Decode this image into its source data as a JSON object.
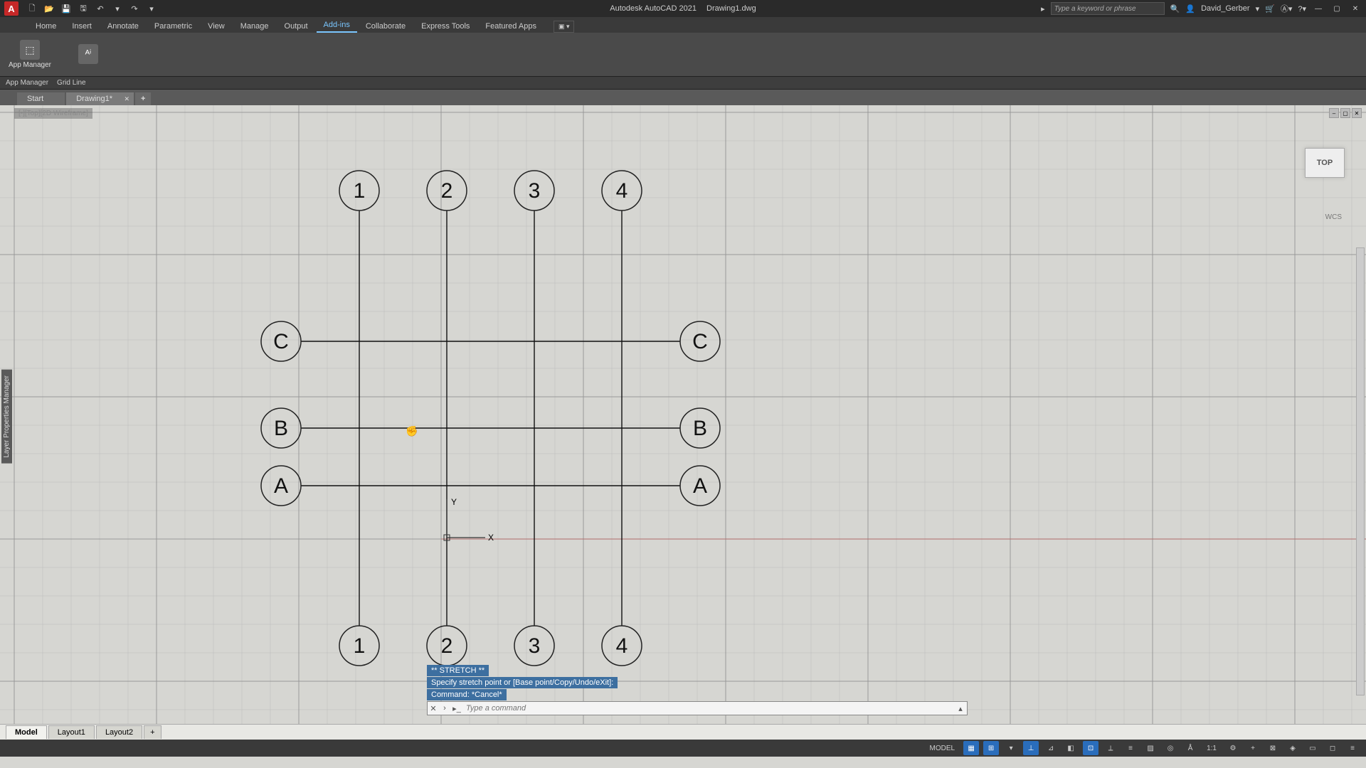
{
  "title": {
    "app": "Autodesk AutoCAD 2021",
    "file": "Drawing1.dwg"
  },
  "qat": [
    {
      "name": "new",
      "glyph": "🗋"
    },
    {
      "name": "open",
      "glyph": "📂"
    },
    {
      "name": "save",
      "glyph": "💾"
    },
    {
      "name": "saveas",
      "glyph": "🖫"
    },
    {
      "name": "undo",
      "glyph": "↶"
    },
    {
      "name": "undo-drop",
      "glyph": "▾"
    },
    {
      "name": "redo",
      "glyph": "↷"
    },
    {
      "name": "redo-drop",
      "glyph": "▾"
    }
  ],
  "search": {
    "placeholder": "Type a keyword or phrase"
  },
  "user": {
    "name": "David_Gerber"
  },
  "ribbon_tabs": [
    "Home",
    "Insert",
    "Annotate",
    "Parametric",
    "View",
    "Manage",
    "Output",
    "Add-ins",
    "Collaborate",
    "Express Tools",
    "Featured Apps"
  ],
  "active_ribbon_tab": 7,
  "ribbon_panels": [
    {
      "label": "App Manager",
      "icon": "⬚"
    },
    {
      "label": "",
      "icon": "ᴬⁱ"
    }
  ],
  "ribbon_sub": [
    "App Manager",
    "Grid Line"
  ],
  "doc_tabs": [
    {
      "label": "Start",
      "active": false
    },
    {
      "label": "Drawing1*",
      "active": true
    }
  ],
  "canvas_badge": "[-][Top][2D Wireframe]",
  "viewcube": "TOP",
  "wcs": "WCS",
  "ucs": {
    "y": "Y",
    "x": "X"
  },
  "grid_bubbles": {
    "top": [
      "1",
      "2",
      "3",
      "4"
    ],
    "bottom": [
      "1",
      "2",
      "3",
      "4"
    ],
    "left": [
      "C",
      "B",
      "A"
    ],
    "right": [
      "C",
      "B",
      "A"
    ]
  },
  "layout_tabs": [
    "Model",
    "Layout1",
    "Layout2"
  ],
  "active_layout": 0,
  "cmd_history": [
    {
      "text": "** STRETCH **",
      "hl": true
    },
    {
      "text": "Specify stretch point or [Base point/Copy/Undo/eXit]:",
      "hl": true
    },
    {
      "text": "Command: *Cancel*",
      "hl": true
    }
  ],
  "cmd_input": {
    "placeholder": "Type a command"
  },
  "statusbar": {
    "model": "MODEL",
    "buttons": [
      {
        "name": "grid",
        "glyph": "▦",
        "on": true
      },
      {
        "name": "snap",
        "glyph": "⊞",
        "on": true
      },
      {
        "name": "infer",
        "glyph": "▾",
        "on": false
      },
      {
        "name": "ortho",
        "glyph": "⊥",
        "on": true
      },
      {
        "name": "polar",
        "glyph": "⊿",
        "on": false
      },
      {
        "name": "iso",
        "glyph": "◧",
        "on": false
      },
      {
        "name": "osnap",
        "glyph": "⊡",
        "on": true
      },
      {
        "name": "otrack",
        "glyph": "⟂",
        "on": false
      },
      {
        "name": "lwt",
        "glyph": "≡",
        "on": false
      },
      {
        "name": "transp",
        "glyph": "▨",
        "on": false
      },
      {
        "name": "cycle",
        "glyph": "◎",
        "on": false
      },
      {
        "name": "annomon",
        "glyph": "Å",
        "on": false
      }
    ],
    "scale": "1:1",
    "right_buttons": [
      {
        "name": "gear",
        "glyph": "⚙"
      },
      {
        "name": "plus",
        "glyph": "+"
      },
      {
        "name": "iso2",
        "glyph": "⊠"
      },
      {
        "name": "qp",
        "glyph": "◈"
      },
      {
        "name": "ws",
        "glyph": "▭"
      },
      {
        "name": "clean",
        "glyph": "◻"
      },
      {
        "name": "menu",
        "glyph": "≡"
      }
    ]
  },
  "side_palette": "Layer Properties Manager"
}
